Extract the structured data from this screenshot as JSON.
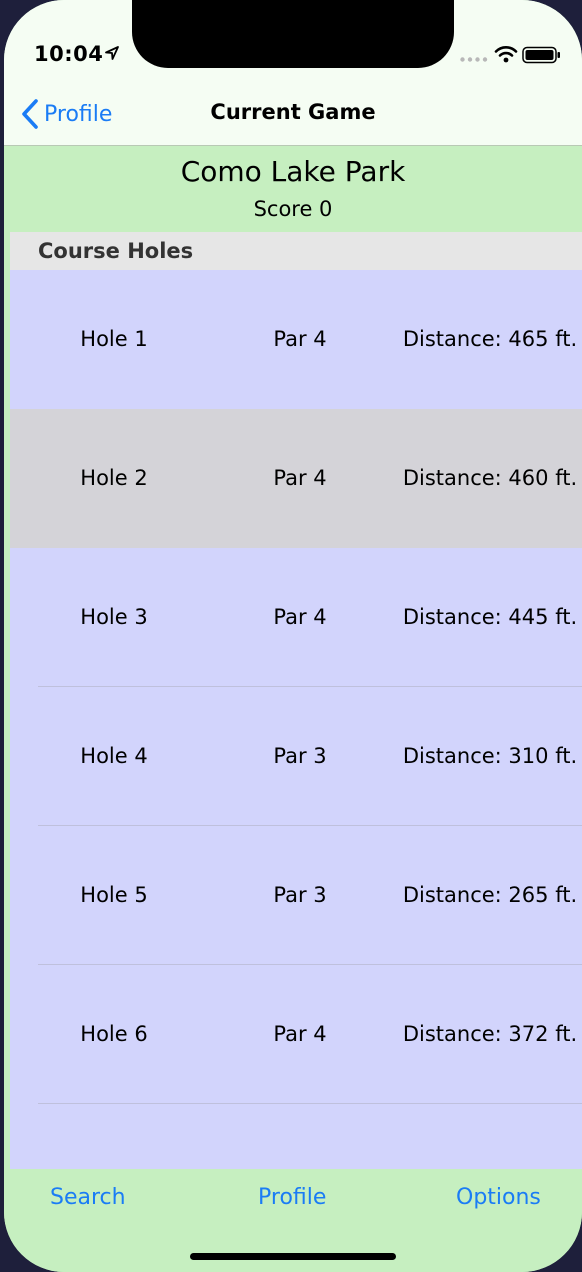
{
  "status_bar": {
    "time": "10:04",
    "icons": [
      "location-arrow-icon",
      "signal-dots-icon",
      "wifi-icon",
      "battery-icon"
    ]
  },
  "nav": {
    "back_label": "Profile",
    "title": "Current Game"
  },
  "header": {
    "course_name": "Como Lake Park",
    "score": "Score 0"
  },
  "table": {
    "section_title": "Course Holes",
    "rows": [
      {
        "hole": "Hole 1",
        "par": "Par 4",
        "distance": "Distance: 465 ft."
      },
      {
        "hole": "Hole 2",
        "par": "Par 4",
        "distance": "Distance: 460 ft."
      },
      {
        "hole": "Hole 3",
        "par": "Par 4",
        "distance": "Distance: 445 ft."
      },
      {
        "hole": "Hole 4",
        "par": "Par 3",
        "distance": "Distance: 310 ft."
      },
      {
        "hole": "Hole 5",
        "par": "Par 3",
        "distance": "Distance: 265 ft."
      },
      {
        "hole": "Hole 6",
        "par": "Par 4",
        "distance": "Distance: 372 ft."
      }
    ]
  },
  "tab_bar": {
    "search": "Search",
    "profile": "Profile",
    "options": "Options"
  },
  "colors": {
    "accent": "#1a7cf5",
    "header_background": "#c6efc0",
    "row_background": "#d2d4fc",
    "selected_row_background": "#d4d3d8",
    "section_header_background": "#e6e6e6"
  }
}
